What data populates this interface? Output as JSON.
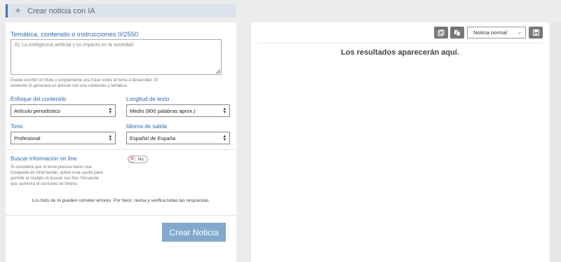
{
  "header": {
    "title": "Crear noticia con IA",
    "icon": "sparkle-icon"
  },
  "form": {
    "topic_label": "Temática, contenido o instrucciones 0/2550",
    "topic_placeholder": "Ej: La inteligencia artificial y su impacto en la sociedad.",
    "topic_help_1": "Puede escribir un título o simplemente una frase sobre el tema a desarrollar. El",
    "topic_help_2": "asistente IA generará un artículo con ese contenido y temática.",
    "focus_label": "Enfoque del contenido",
    "focus_value": "Artículo periodístico",
    "length_label": "Longitud de texto",
    "length_value": "Medio (800 palabras aprox.)",
    "tone_label": "Tono",
    "tone_value": "Profesional",
    "language_label": "Idioma de salida",
    "language_value": "Español de España",
    "online_label": "Buscar información on line",
    "online_help_1": "Si considera que el tema precisa hacer una",
    "online_help_2": "búsqueda de información, active esta casilla para",
    "online_help_3": "permitir al modelo IA buscar con line. Recuerde",
    "online_help_4": "que aumenta el consumo de tokens.",
    "online_toggle": "No",
    "disclaimer": "Los bots de IA pueden cometer errores. Por favor, revisa y verifica todas las respuestas.",
    "create_button": "Crear Noticia"
  },
  "results": {
    "type_select": "Noticia normal",
    "placeholder": "Los resultados aparecerán aquí.",
    "tool_icons": [
      "copy-text-icon",
      "copy-icon",
      "save-icon"
    ]
  },
  "colors": {
    "accent": "#3a73b3",
    "label": "#2b6cb0",
    "button": "#82a9cd"
  }
}
